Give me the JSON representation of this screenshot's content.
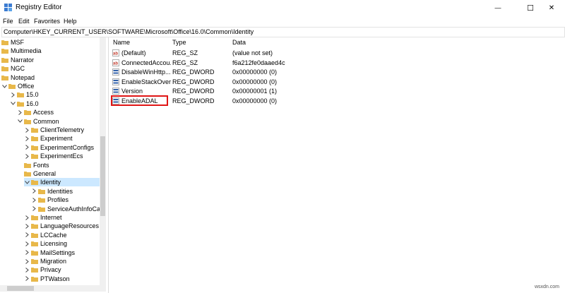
{
  "window": {
    "title": "Registry Editor",
    "minimize_glyph": "—",
    "maximize_glyph": "☐",
    "close_glyph": "✕"
  },
  "menu": [
    "File",
    "Edit",
    "Favorites",
    "Help"
  ],
  "address": "Computer\\HKEY_CURRENT_USER\\SOFTWARE\\Microsoft\\Office\\16.0\\Common\\Identity",
  "tree": {
    "items": [
      {
        "label": "MSF",
        "expanded": null
      },
      {
        "label": "Multimedia",
        "expanded": null
      },
      {
        "label": "Narrator",
        "expanded": null
      },
      {
        "label": "NGC",
        "expanded": null
      },
      {
        "label": "Notepad",
        "expanded": null
      },
      {
        "label": "Office",
        "expanded": true
      },
      {
        "label": "15.0",
        "expanded": false
      },
      {
        "label": "16.0",
        "expanded": true
      },
      {
        "label": "Access",
        "expanded": false
      },
      {
        "label": "Common",
        "expanded": true
      },
      {
        "label": "ClientTelemetry",
        "expanded": false
      },
      {
        "label": "Experiment",
        "expanded": false
      },
      {
        "label": "ExperimentConfigs",
        "expanded": false
      },
      {
        "label": "ExperimentEcs",
        "expanded": false
      },
      {
        "label": "Fonts",
        "expanded": null
      },
      {
        "label": "General",
        "expanded": null
      },
      {
        "label": "Identity",
        "expanded": true,
        "selected": true
      },
      {
        "label": "Identities",
        "expanded": false
      },
      {
        "label": "Profiles",
        "expanded": false
      },
      {
        "label": "ServiceAuthInfoCache",
        "expanded": false
      },
      {
        "label": "Internet",
        "expanded": false
      },
      {
        "label": "LanguageResources",
        "expanded": false
      },
      {
        "label": "LCCache",
        "expanded": false
      },
      {
        "label": "Licensing",
        "expanded": false
      },
      {
        "label": "MailSettings",
        "expanded": false
      },
      {
        "label": "Migration",
        "expanded": false
      },
      {
        "label": "Privacy",
        "expanded": false
      },
      {
        "label": "PTWatson",
        "expanded": false
      }
    ]
  },
  "columns": {
    "name": "Name",
    "type": "Type",
    "data": "Data"
  },
  "values": [
    {
      "name": "(Default)",
      "type": "REG_SZ",
      "data": "(value not set)",
      "icon": "string-value-icon"
    },
    {
      "name": "ConnectedAccou...",
      "type": "REG_SZ",
      "data": "f6a212fe0daaed4c",
      "icon": "string-value-icon"
    },
    {
      "name": "DisableWinHttp...",
      "type": "REG_DWORD",
      "data": "0x00000000 (0)",
      "icon": "dword-value-icon"
    },
    {
      "name": "EnableStackOver...",
      "type": "REG_DWORD",
      "data": "0x00000000 (0)",
      "icon": "dword-value-icon"
    },
    {
      "name": "Version",
      "type": "REG_DWORD",
      "data": "0x00000001 (1)",
      "icon": "dword-value-icon"
    },
    {
      "name": "EnableADAL",
      "type": "REG_DWORD",
      "data": "0x00000000 (0)",
      "icon": "dword-value-icon",
      "editing": true
    }
  ],
  "colors": {
    "folder": "#e8b84a",
    "selection": "#cce8ff",
    "highlight_box": "#e01616",
    "string_icon": "#c0392b",
    "dword_icon": "#2f5fa8"
  },
  "watermark": "wsxdn.com"
}
